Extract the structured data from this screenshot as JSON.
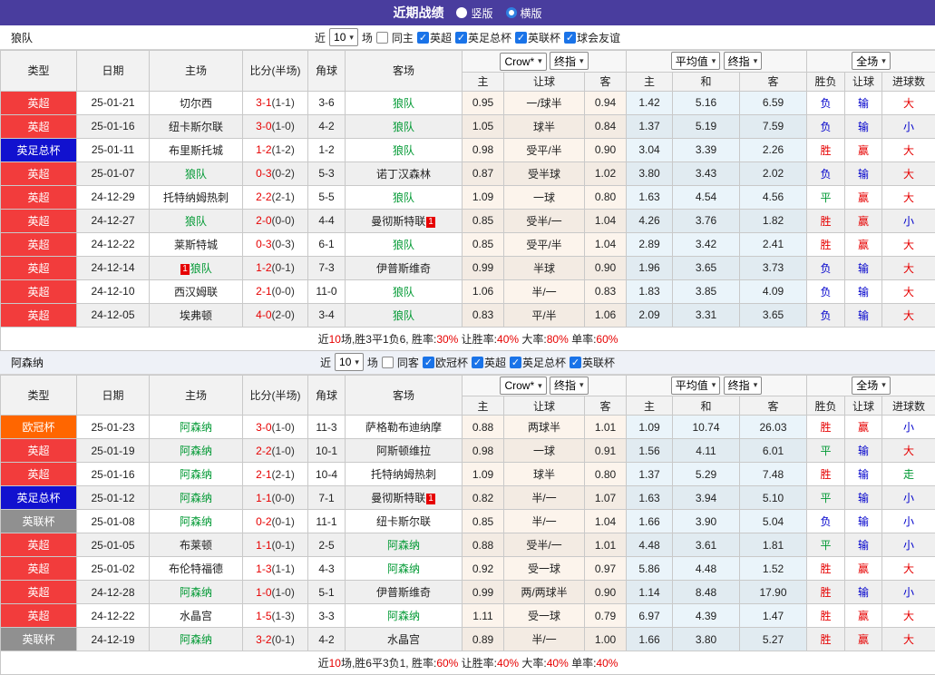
{
  "title_bar": {
    "title": "近期战绩",
    "vertical_label": "竖版",
    "horizontal_label": "横版"
  },
  "table_header": {
    "left_cols": [
      "类型",
      "日期",
      "主场",
      "比分(半场)",
      "角球",
      "客场"
    ],
    "group1_selects": [
      "Crow*",
      "终指"
    ],
    "group2_selects": [
      "平均值",
      "终指"
    ],
    "group3_selects": [
      "全场"
    ],
    "sub_cols": [
      "主",
      "让球",
      "客",
      "主",
      "和",
      "客",
      "胜负",
      "让球",
      "进球数"
    ]
  },
  "colors": {
    "titlebar_bg": "#493d9e",
    "type_colors": {
      "英超": "#f23c3c",
      "英足总杯": "#1111cf",
      "欧冠杯": "#ff6600",
      "英联杯": "#909090"
    },
    "result_colors": {
      "胜": "red",
      "平": "green",
      "负": "blue",
      "赢": "red",
      "输": "blue",
      "大": "red",
      "小": "blue",
      "走": "green"
    },
    "self_team_color": "#009933",
    "score_color": "#e60000",
    "checkbox_on_color": "#1a73e8"
  },
  "sections": [
    {
      "team": "狼队",
      "filter": {
        "near": "近",
        "count": "10",
        "matches": "场",
        "same_label": "同主",
        "leagues": [
          "英超",
          "英足总杯",
          "英联杯",
          "球会友谊"
        ]
      },
      "rows": [
        {
          "type": "英超",
          "date": "25-01-21",
          "home": "切尔西",
          "home_self": false,
          "home_badge": null,
          "score": "3-1",
          "half": "(1-1)",
          "corner": "3-6",
          "away": "狼队",
          "away_self": true,
          "away_badge": null,
          "o1": [
            "0.95",
            "一/球半",
            "0.94"
          ],
          "o2": [
            "1.42",
            "5.16",
            "6.59"
          ],
          "res": [
            "负",
            "输",
            "大"
          ]
        },
        {
          "type": "英超",
          "date": "25-01-16",
          "home": "纽卡斯尔联",
          "home_self": false,
          "home_badge": null,
          "score": "3-0",
          "half": "(1-0)",
          "corner": "4-2",
          "away": "狼队",
          "away_self": true,
          "away_badge": null,
          "o1": [
            "1.05",
            "球半",
            "0.84"
          ],
          "o2": [
            "1.37",
            "5.19",
            "7.59"
          ],
          "res": [
            "负",
            "输",
            "小"
          ]
        },
        {
          "type": "英足总杯",
          "date": "25-01-11",
          "home": "布里斯托城",
          "home_self": false,
          "home_badge": null,
          "score": "1-2",
          "half": "(1-2)",
          "corner": "1-2",
          "away": "狼队",
          "away_self": true,
          "away_badge": null,
          "o1": [
            "0.98",
            "受平/半",
            "0.90"
          ],
          "o2": [
            "3.04",
            "3.39",
            "2.26"
          ],
          "res": [
            "胜",
            "赢",
            "大"
          ]
        },
        {
          "type": "英超",
          "date": "25-01-07",
          "home": "狼队",
          "home_self": true,
          "home_badge": null,
          "score": "0-3",
          "half": "(0-2)",
          "corner": "5-3",
          "away": "诺丁汉森林",
          "away_self": false,
          "away_badge": null,
          "o1": [
            "0.87",
            "受半球",
            "1.02"
          ],
          "o2": [
            "3.80",
            "3.43",
            "2.02"
          ],
          "res": [
            "负",
            "输",
            "大"
          ]
        },
        {
          "type": "英超",
          "date": "24-12-29",
          "home": "托特纳姆热刺",
          "home_self": false,
          "home_badge": null,
          "score": "2-2",
          "half": "(2-1)",
          "corner": "5-5",
          "away": "狼队",
          "away_self": true,
          "away_badge": null,
          "o1": [
            "1.09",
            "一球",
            "0.80"
          ],
          "o2": [
            "1.63",
            "4.54",
            "4.56"
          ],
          "res": [
            "平",
            "赢",
            "大"
          ]
        },
        {
          "type": "英超",
          "date": "24-12-27",
          "home": "狼队",
          "home_self": true,
          "home_badge": null,
          "score": "2-0",
          "half": "(0-0)",
          "corner": "4-4",
          "away": "曼彻斯特联",
          "away_self": false,
          "away_badge": "after",
          "o1": [
            "0.85",
            "受半/一",
            "1.04"
          ],
          "o2": [
            "4.26",
            "3.76",
            "1.82"
          ],
          "res": [
            "胜",
            "赢",
            "小"
          ]
        },
        {
          "type": "英超",
          "date": "24-12-22",
          "home": "莱斯特城",
          "home_self": false,
          "home_badge": null,
          "score": "0-3",
          "half": "(0-3)",
          "corner": "6-1",
          "away": "狼队",
          "away_self": true,
          "away_badge": null,
          "o1": [
            "0.85",
            "受平/半",
            "1.04"
          ],
          "o2": [
            "2.89",
            "3.42",
            "2.41"
          ],
          "res": [
            "胜",
            "赢",
            "大"
          ]
        },
        {
          "type": "英超",
          "date": "24-12-14",
          "home": "狼队",
          "home_self": true,
          "home_badge": "before",
          "score": "1-2",
          "half": "(0-1)",
          "corner": "7-3",
          "away": "伊普斯维奇",
          "away_self": false,
          "away_badge": null,
          "o1": [
            "0.99",
            "半球",
            "0.90"
          ],
          "o2": [
            "1.96",
            "3.65",
            "3.73"
          ],
          "res": [
            "负",
            "输",
            "大"
          ]
        },
        {
          "type": "英超",
          "date": "24-12-10",
          "home": "西汉姆联",
          "home_self": false,
          "home_badge": null,
          "score": "2-1",
          "half": "(0-0)",
          "corner": "11-0",
          "away": "狼队",
          "away_self": true,
          "away_badge": null,
          "o1": [
            "1.06",
            "半/一",
            "0.83"
          ],
          "o2": [
            "1.83",
            "3.85",
            "4.09"
          ],
          "res": [
            "负",
            "输",
            "大"
          ]
        },
        {
          "type": "英超",
          "date": "24-12-05",
          "home": "埃弗顿",
          "home_self": false,
          "home_badge": null,
          "score": "4-0",
          "half": "(2-0)",
          "corner": "3-4",
          "away": "狼队",
          "away_self": true,
          "away_badge": null,
          "o1": [
            "0.83",
            "平/半",
            "1.06"
          ],
          "o2": [
            "2.09",
            "3.31",
            "3.65"
          ],
          "res": [
            "负",
            "输",
            "大"
          ]
        }
      ],
      "summary": [
        [
          "近",
          "k"
        ],
        [
          "10",
          "r"
        ],
        [
          "场,胜3平1负6, 胜率:",
          "k"
        ],
        [
          "30%",
          "r"
        ],
        [
          " 让胜率:",
          "k"
        ],
        [
          "40%",
          "r"
        ],
        [
          " 大率:",
          "k"
        ],
        [
          "80%",
          "r"
        ],
        [
          " 单率:",
          "k"
        ],
        [
          "60%",
          "r"
        ]
      ]
    },
    {
      "team": "阿森纳",
      "filter": {
        "near": "近",
        "count": "10",
        "matches": "场",
        "same_label": "同客",
        "leagues": [
          "欧冠杯",
          "英超",
          "英足总杯",
          "英联杯"
        ]
      },
      "rows": [
        {
          "type": "欧冠杯",
          "date": "25-01-23",
          "home": "阿森纳",
          "home_self": true,
          "home_badge": null,
          "score": "3-0",
          "half": "(1-0)",
          "corner": "11-3",
          "away": "萨格勒布迪纳摩",
          "away_self": false,
          "away_badge": null,
          "o1": [
            "0.88",
            "两球半",
            "1.01"
          ],
          "o2": [
            "1.09",
            "10.74",
            "26.03"
          ],
          "res": [
            "胜",
            "赢",
            "小"
          ]
        },
        {
          "type": "英超",
          "date": "25-01-19",
          "home": "阿森纳",
          "home_self": true,
          "home_badge": null,
          "score": "2-2",
          "half": "(1-0)",
          "corner": "10-1",
          "away": "阿斯顿维拉",
          "away_self": false,
          "away_badge": null,
          "o1": [
            "0.98",
            "一球",
            "0.91"
          ],
          "o2": [
            "1.56",
            "4.11",
            "6.01"
          ],
          "res": [
            "平",
            "输",
            "大"
          ]
        },
        {
          "type": "英超",
          "date": "25-01-16",
          "home": "阿森纳",
          "home_self": true,
          "home_badge": null,
          "score": "2-1",
          "half": "(2-1)",
          "corner": "10-4",
          "away": "托特纳姆热刺",
          "away_self": false,
          "away_badge": null,
          "o1": [
            "1.09",
            "球半",
            "0.80"
          ],
          "o2": [
            "1.37",
            "5.29",
            "7.48"
          ],
          "res": [
            "胜",
            "输",
            "走"
          ]
        },
        {
          "type": "英足总杯",
          "date": "25-01-12",
          "home": "阿森纳",
          "home_self": true,
          "home_badge": null,
          "score": "1-1",
          "half": "(0-0)",
          "corner": "7-1",
          "away": "曼彻斯特联",
          "away_self": false,
          "away_badge": "after",
          "o1": [
            "0.82",
            "半/一",
            "1.07"
          ],
          "o2": [
            "1.63",
            "3.94",
            "5.10"
          ],
          "res": [
            "平",
            "输",
            "小"
          ]
        },
        {
          "type": "英联杯",
          "date": "25-01-08",
          "home": "阿森纳",
          "home_self": true,
          "home_badge": null,
          "score": "0-2",
          "half": "(0-1)",
          "corner": "11-1",
          "away": "纽卡斯尔联",
          "away_self": false,
          "away_badge": null,
          "o1": [
            "0.85",
            "半/一",
            "1.04"
          ],
          "o2": [
            "1.66",
            "3.90",
            "5.04"
          ],
          "res": [
            "负",
            "输",
            "小"
          ]
        },
        {
          "type": "英超",
          "date": "25-01-05",
          "home": "布莱顿",
          "home_self": false,
          "home_badge": null,
          "score": "1-1",
          "half": "(0-1)",
          "corner": "2-5",
          "away": "阿森纳",
          "away_self": true,
          "away_badge": null,
          "o1": [
            "0.88",
            "受半/一",
            "1.01"
          ],
          "o2": [
            "4.48",
            "3.61",
            "1.81"
          ],
          "res": [
            "平",
            "输",
            "小"
          ]
        },
        {
          "type": "英超",
          "date": "25-01-02",
          "home": "布伦特福德",
          "home_self": false,
          "home_badge": null,
          "score": "1-3",
          "half": "(1-1)",
          "corner": "4-3",
          "away": "阿森纳",
          "away_self": true,
          "away_badge": null,
          "o1": [
            "0.92",
            "受一球",
            "0.97"
          ],
          "o2": [
            "5.86",
            "4.48",
            "1.52"
          ],
          "res": [
            "胜",
            "赢",
            "大"
          ]
        },
        {
          "type": "英超",
          "date": "24-12-28",
          "home": "阿森纳",
          "home_self": true,
          "home_badge": null,
          "score": "1-0",
          "half": "(1-0)",
          "corner": "5-1",
          "away": "伊普斯维奇",
          "away_self": false,
          "away_badge": null,
          "o1": [
            "0.99",
            "两/两球半",
            "0.90"
          ],
          "o2": [
            "1.14",
            "8.48",
            "17.90"
          ],
          "res": [
            "胜",
            "输",
            "小"
          ]
        },
        {
          "type": "英超",
          "date": "24-12-22",
          "home": "水晶宫",
          "home_self": false,
          "home_badge": null,
          "score": "1-5",
          "half": "(1-3)",
          "corner": "3-3",
          "away": "阿森纳",
          "away_self": true,
          "away_badge": null,
          "o1": [
            "1.11",
            "受一球",
            "0.79"
          ],
          "o2": [
            "6.97",
            "4.39",
            "1.47"
          ],
          "res": [
            "胜",
            "赢",
            "大"
          ]
        },
        {
          "type": "英联杯",
          "date": "24-12-19",
          "home": "阿森纳",
          "home_self": true,
          "home_badge": null,
          "score": "3-2",
          "half": "(0-1)",
          "corner": "4-2",
          "away": "水晶宫",
          "away_self": false,
          "away_badge": null,
          "o1": [
            "0.89",
            "半/一",
            "1.00"
          ],
          "o2": [
            "1.66",
            "3.80",
            "5.27"
          ],
          "res": [
            "胜",
            "赢",
            "大"
          ]
        }
      ],
      "summary": [
        [
          "近",
          "k"
        ],
        [
          "10",
          "r"
        ],
        [
          "场,胜6平3负1, 胜率:",
          "k"
        ],
        [
          "60%",
          "r"
        ],
        [
          " 让胜率:",
          "k"
        ],
        [
          "40%",
          "r"
        ],
        [
          " 大率:",
          "k"
        ],
        [
          "40%",
          "r"
        ],
        [
          " 单率:",
          "k"
        ],
        [
          "40%",
          "r"
        ]
      ]
    }
  ]
}
